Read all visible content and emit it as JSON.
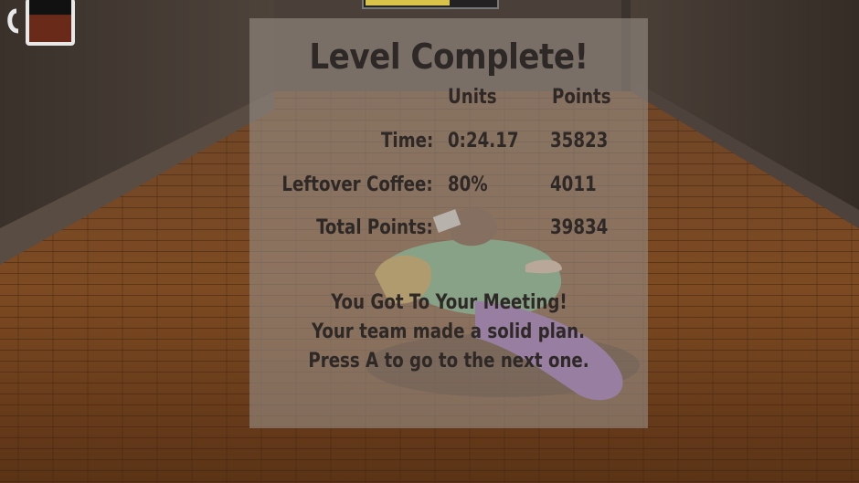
{
  "hud": {
    "coffee_level": 0.65,
    "progress": 0.65,
    "colors": {
      "coffee": "#6a2a1a",
      "mug": "#e8e8e8",
      "progress_fill": "#d8c24a"
    }
  },
  "panel": {
    "title": "Level Complete!",
    "headers": {
      "units": "Units",
      "points": "Points"
    },
    "rows": [
      {
        "label": "Time:",
        "units": "0:24.17",
        "points": "35823"
      },
      {
        "label": "Leftover Coffee:",
        "units": "80%",
        "points": "4011"
      },
      {
        "label": "Total Points:",
        "units": "",
        "points": "39834"
      }
    ],
    "message": [
      "You Got To Your Meeting!",
      "Your team made a solid plan.",
      "Press A to go to the next one."
    ]
  }
}
